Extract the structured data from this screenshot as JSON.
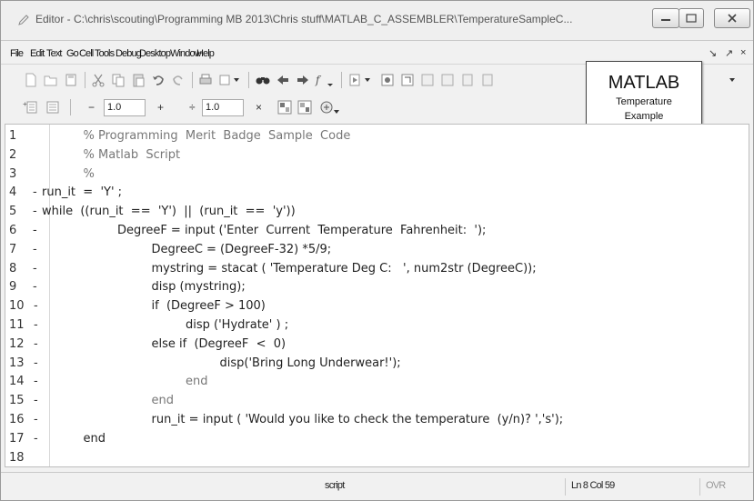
{
  "window": {
    "title": "Editor - C:\\chris\\scouting\\Programming MB 2013\\Chris stuff\\MATLAB_C_ASSEMBLER\\TemperatureSampleC..."
  },
  "menubar": {
    "items": [
      "File",
      "Edit",
      "Text",
      "Go",
      "Cell",
      "Tools",
      "Debug",
      "Desktop",
      "Window",
      "Help"
    ],
    "right_controls": [
      "↘",
      "↗",
      "×"
    ]
  },
  "toolbar2": {
    "minus": "−",
    "field1": "1.0",
    "plus": "+",
    "divide": "÷",
    "field2": "1.0",
    "times": "×"
  },
  "callout": {
    "title": "MATLAB",
    "subtitle_line1": "Temperature",
    "subtitle_line2": "Example"
  },
  "editor": {
    "lines": [
      {
        "num": "1",
        "marker": "",
        "text": "% Programming  Merit  Badge  Sample  Code",
        "kind": "comment",
        "indent": 1
      },
      {
        "num": "2",
        "marker": "",
        "text": "% Matlab  Script",
        "kind": "comment",
        "indent": 1
      },
      {
        "num": "3",
        "marker": "",
        "text": "%",
        "kind": "comment",
        "indent": 1
      },
      {
        "num": "4",
        "marker": "-",
        "text": "run_it  =  'Y' ;",
        "kind": "code",
        "indent": 0
      },
      {
        "num": "5",
        "marker": "-",
        "text": "while  ((run_it  ==  'Y')  ||  (run_it  ==  'y'))",
        "kind": "code",
        "indent": 0
      },
      {
        "num": "6",
        "marker": "-",
        "text": "DegreeF = input ('Enter  Current  Temperature  Fahrenheit:  ');",
        "kind": "code",
        "indent": 2
      },
      {
        "num": "7",
        "marker": "-",
        "text": "DegreeC = (DegreeF-32) *5/9;",
        "kind": "code",
        "indent": 3
      },
      {
        "num": "8",
        "marker": "-",
        "text": "mystring = stacat ( 'Temperature Deg C:   ', num2str (DegreeC));",
        "kind": "code",
        "indent": 3
      },
      {
        "num": "9",
        "marker": "-",
        "text": "disp (mystring);",
        "kind": "code",
        "indent": 3
      },
      {
        "num": "10",
        "marker": "-",
        "text": "if  (DegreeF > 100)",
        "kind": "code",
        "indent": 3
      },
      {
        "num": "11",
        "marker": "-",
        "text": "disp ('Hydrate' ) ;",
        "kind": "code",
        "indent": 4
      },
      {
        "num": "12",
        "marker": "-",
        "text": "else if  (DegreeF  <  0)",
        "kind": "code",
        "indent": 3
      },
      {
        "num": "13",
        "marker": "-",
        "text": "disp('Bring Long Underwear!');",
        "kind": "code",
        "indent": 5
      },
      {
        "num": "14",
        "marker": "-",
        "text": "end",
        "kind": "comment",
        "indent": 4
      },
      {
        "num": "15",
        "marker": "-",
        "text": "end",
        "kind": "comment",
        "indent": 3
      },
      {
        "num": "16",
        "marker": "-",
        "text": "run_it = input ( 'Would you like to check the temperature  (y/n)? ','s');",
        "kind": "code",
        "indent": 3
      },
      {
        "num": "17",
        "marker": "-",
        "text": "end",
        "kind": "code",
        "indent": 1
      },
      {
        "num": "18",
        "marker": "",
        "text": "",
        "kind": "code",
        "indent": 0
      }
    ]
  },
  "statusbar": {
    "mode": "script",
    "position": "Ln 8  Col 59",
    "ovr": "OVR"
  }
}
